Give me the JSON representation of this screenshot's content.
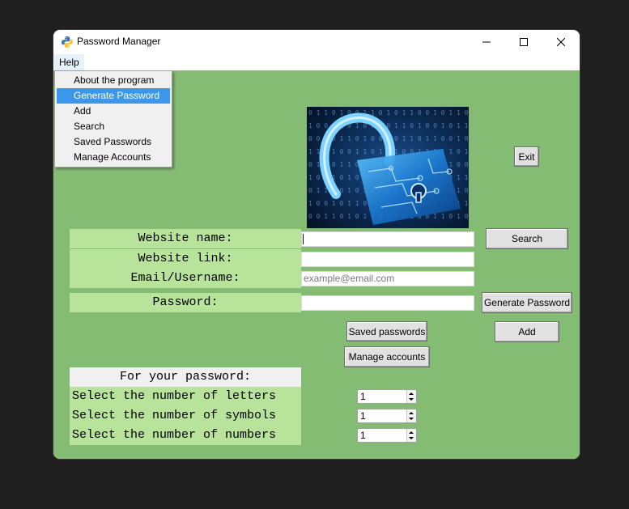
{
  "window": {
    "title": "Password Manager",
    "icon": "python-icon",
    "controls": {
      "minimize": "minimize-icon",
      "maximize": "maximize-icon",
      "close": "close-icon"
    }
  },
  "menu": {
    "help_label": "Help",
    "items": [
      {
        "label": "About the program"
      },
      {
        "label": "Generate Password",
        "highlighted": true
      },
      {
        "label": "Add"
      },
      {
        "label": "Search"
      },
      {
        "label": "Saved Passwords"
      },
      {
        "label": "Manage Accounts"
      }
    ]
  },
  "colors": {
    "background": "#85bc73",
    "label_bg": "#b8e39b",
    "header_bg": "#f0f0f0",
    "menu_highlight": "#3b97ea"
  },
  "buttons": {
    "exit": "Exit",
    "search": "Search",
    "generate": "Generate Password",
    "add": "Add",
    "saved": "Saved passwords",
    "manage": "Manage accounts"
  },
  "labels": {
    "website_name": "Website name:",
    "website_link": "Website link:",
    "email": "Email/Username:",
    "password": "Password:",
    "for_password": "For your password:",
    "letters": "Select the number of letters",
    "symbols": "Select the number of symbols",
    "numbers": "Select the number of numbers"
  },
  "inputs": {
    "website_name": "",
    "website_link": "",
    "email_placeholder": "example@email.com",
    "password": ""
  },
  "spinners": {
    "letters": "1",
    "symbols": "1",
    "numbers": "1"
  }
}
